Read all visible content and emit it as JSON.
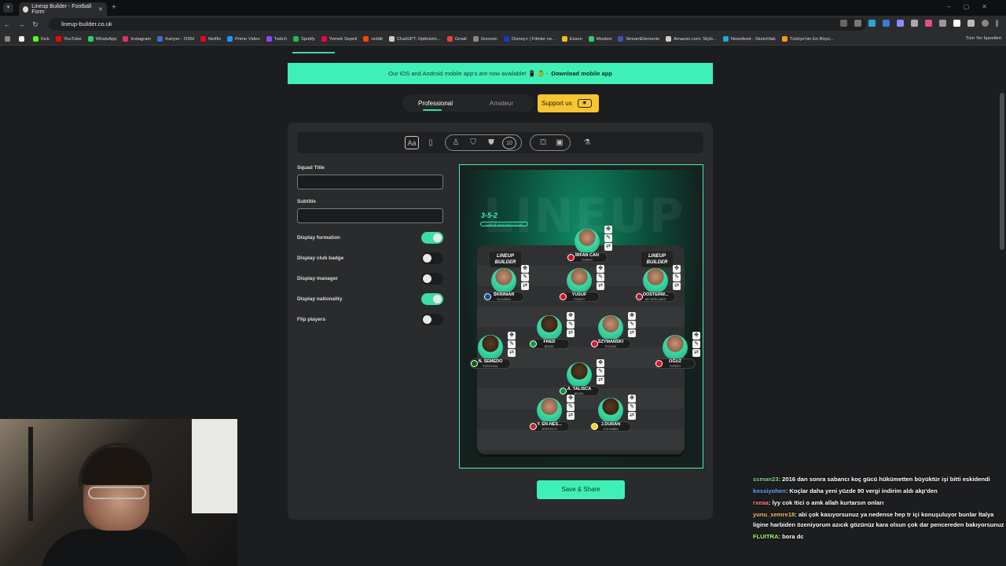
{
  "browser": {
    "tab_title": "Lineup Builder - Football Form",
    "url": "lineup-builder.co.uk",
    "bookmarks": [
      {
        "label": "Kick",
        "color": "#53fc18"
      },
      {
        "label": "YouTube",
        "color": "#ff0000"
      },
      {
        "label": "WhatsApp",
        "color": "#25d366"
      },
      {
        "label": "Instagram",
        "color": "#e1306c"
      },
      {
        "label": "Kariyer - OSM",
        "color": "#3b6fd8"
      },
      {
        "label": "Netflix",
        "color": "#e50914"
      },
      {
        "label": "Prime Video",
        "color": "#1a98ff"
      },
      {
        "label": "Twitch",
        "color": "#9146ff"
      },
      {
        "label": "Spotify",
        "color": "#1db954"
      },
      {
        "label": "Yemek Sepeti",
        "color": "#ea004b"
      },
      {
        "label": "reddit",
        "color": "#ff4500"
      },
      {
        "label": "ChatGPT: Optimizin...",
        "color": "#cccccc"
      },
      {
        "label": "Gmail",
        "color": "#ea4335"
      },
      {
        "label": "Gnoosic",
        "color": "#888888"
      },
      {
        "label": "Disney+ | Filmler ve...",
        "color": "#113ccf"
      },
      {
        "label": "Essen",
        "color": "#f4c20d"
      },
      {
        "label": "Moobot",
        "color": "#2ecc71"
      },
      {
        "label": "StreamElements",
        "color": "#3f51b5"
      },
      {
        "label": "Amazon.com: Stylo...",
        "color": "#cccccc"
      },
      {
        "label": "Newsfeed - Sketchfab",
        "color": "#1caad9"
      },
      {
        "label": "Türkiye'nin En Büyü...",
        "color": "#f39c12"
      }
    ],
    "bookmarks_right": "Tüm Yer İşaretleri"
  },
  "banner": {
    "text": "Our iOS and Android mobile app's are now available! 📱 🍏 -",
    "link": "Download mobile app"
  },
  "mode_tabs": [
    "Professional",
    "Amateur"
  ],
  "support_label": "Support us",
  "form": {
    "squad_title_label": "Squad Title",
    "squad_title_value": "",
    "subtitle_label": "Subtitle",
    "subtitle_value": "",
    "toggles": [
      {
        "label": "Display formation",
        "on": true
      },
      {
        "label": "Display club badge",
        "on": false
      },
      {
        "label": "Display manager",
        "on": false
      },
      {
        "label": "Display nationality",
        "on": true
      },
      {
        "label": "Flip players",
        "on": false
      }
    ]
  },
  "pitch": {
    "formation": "3-5-2",
    "site": "LINEUP-BUILDER.CO.UK",
    "watermark": "LINEUP",
    "logo_text_1": "LINEUP",
    "logo_text_2": "BUILDER",
    "players": [
      {
        "name": "İRFAN CAN",
        "nat": "TURKEY",
        "flag": "#e30a17"
      },
      {
        "name": "ŠKRINIAR",
        "nat": "SLOVAKIA",
        "flag": "#0b4ea2"
      },
      {
        "name": "YUSUF",
        "nat": "TURKEY",
        "flag": "#e30a17"
      },
      {
        "name": "OOSTERW...",
        "nat": "NETHERLANDS",
        "flag": "#ae1c28"
      },
      {
        "name": "FRED",
        "nat": "BRAZIL",
        "flag": "#009c3b"
      },
      {
        "name": "SZYMAŃSKI",
        "nat": "POLAND",
        "flag": "#dc143c"
      },
      {
        "name": "N. SEMEDO",
        "nat": "PORTUGAL",
        "flag": "#006600"
      },
      {
        "name": "OĞUZ",
        "nat": "TURKEY",
        "flag": "#e30a17"
      },
      {
        "name": "A. TALISCA",
        "nat": "BRAZIL",
        "flag": "#009c3b"
      },
      {
        "name": "Y. EN-NES...",
        "nat": "MOROCCO",
        "flag": "#c1272d"
      },
      {
        "name": "J.DURAN",
        "nat": "COLOMBIA",
        "flag": "#fcd116"
      }
    ]
  },
  "save_label": "Save & Share",
  "chat": [
    {
      "user": "ssman23",
      "color": "#7fd67f",
      "text": ": 2016 dan sonra sabancı koç gücü hükümetten büyüktür işi bitti eskidendi"
    },
    {
      "user": "kossiyohen",
      "color": "#6fa8ff",
      "text": ": Koçlar daha yeni yüzde 90 vergi indirim aldı akp'den"
    },
    {
      "user": "rxeaa",
      "color": "#ff8080",
      "text": ": İyy cok Itici o amk allah kurtarsın onları"
    },
    {
      "user": "yunu_semre18",
      "color": "#f0c060",
      "text": ": abi çok kasıyorsunuz ya nedense hep tr içi konuşuluyor bunlar İtalya ligine harbiden özeniyorum azıcık gözünüz kara olsun çok dar pencereden bakıyorsunuz"
    },
    {
      "user": "FLUITRA",
      "color": "#a0ff60",
      "text": ": bora dc"
    }
  ]
}
